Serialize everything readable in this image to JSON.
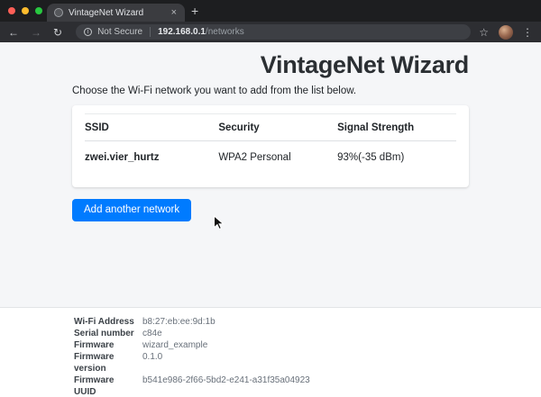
{
  "browser": {
    "tab": {
      "title": "VintageNet Wizard",
      "close_icon": "×",
      "new_tab_icon": "+"
    },
    "toolbar": {
      "back_icon": "←",
      "forward_icon": "→",
      "reload_icon": "↻",
      "info_icon": "i",
      "security_text": "Not Secure",
      "url_host": "192.168.0.1",
      "url_path": "/networks",
      "star_icon": "☆",
      "menu_icon": "⋮"
    },
    "colors": {
      "frame": "#1d1e20",
      "tab": "#3b3c40",
      "toolbar": "#2d2e32",
      "omnibox": "#3d3f44",
      "traffic_red": "#ff5f57",
      "traffic_yellow": "#febc2e",
      "traffic_green": "#28c840"
    }
  },
  "page": {
    "title": "VintageNet Wizard",
    "intro": "Choose the Wi-Fi network you want to add from the list below.",
    "table": {
      "headers": [
        "SSID",
        "Security",
        "Signal Strength"
      ],
      "rows": [
        {
          "ssid": "zwei.vier_hurtz",
          "security": "WPA2 Personal",
          "signal": "93%(-35 dBm)"
        }
      ]
    },
    "button_label": "Add another network",
    "footer": {
      "rows": [
        {
          "label": "Wi-Fi Address",
          "value": "b8:27:eb:ee:9d:1b"
        },
        {
          "label": "Serial number",
          "value": "c84e"
        },
        {
          "label": "Firmware",
          "value": "wizard_example"
        },
        {
          "label": "Firmware version",
          "value": "0.1.0"
        },
        {
          "label": "Firmware UUID",
          "value": "b541e986-2f66-5bd2-e241-a31f35a04923"
        }
      ]
    },
    "colors": {
      "page_background": "#f5f6f8",
      "card_background": "#ffffff",
      "accent_button": "#007bff",
      "text_primary": "#212529",
      "text_secondary": "#68707a"
    }
  }
}
